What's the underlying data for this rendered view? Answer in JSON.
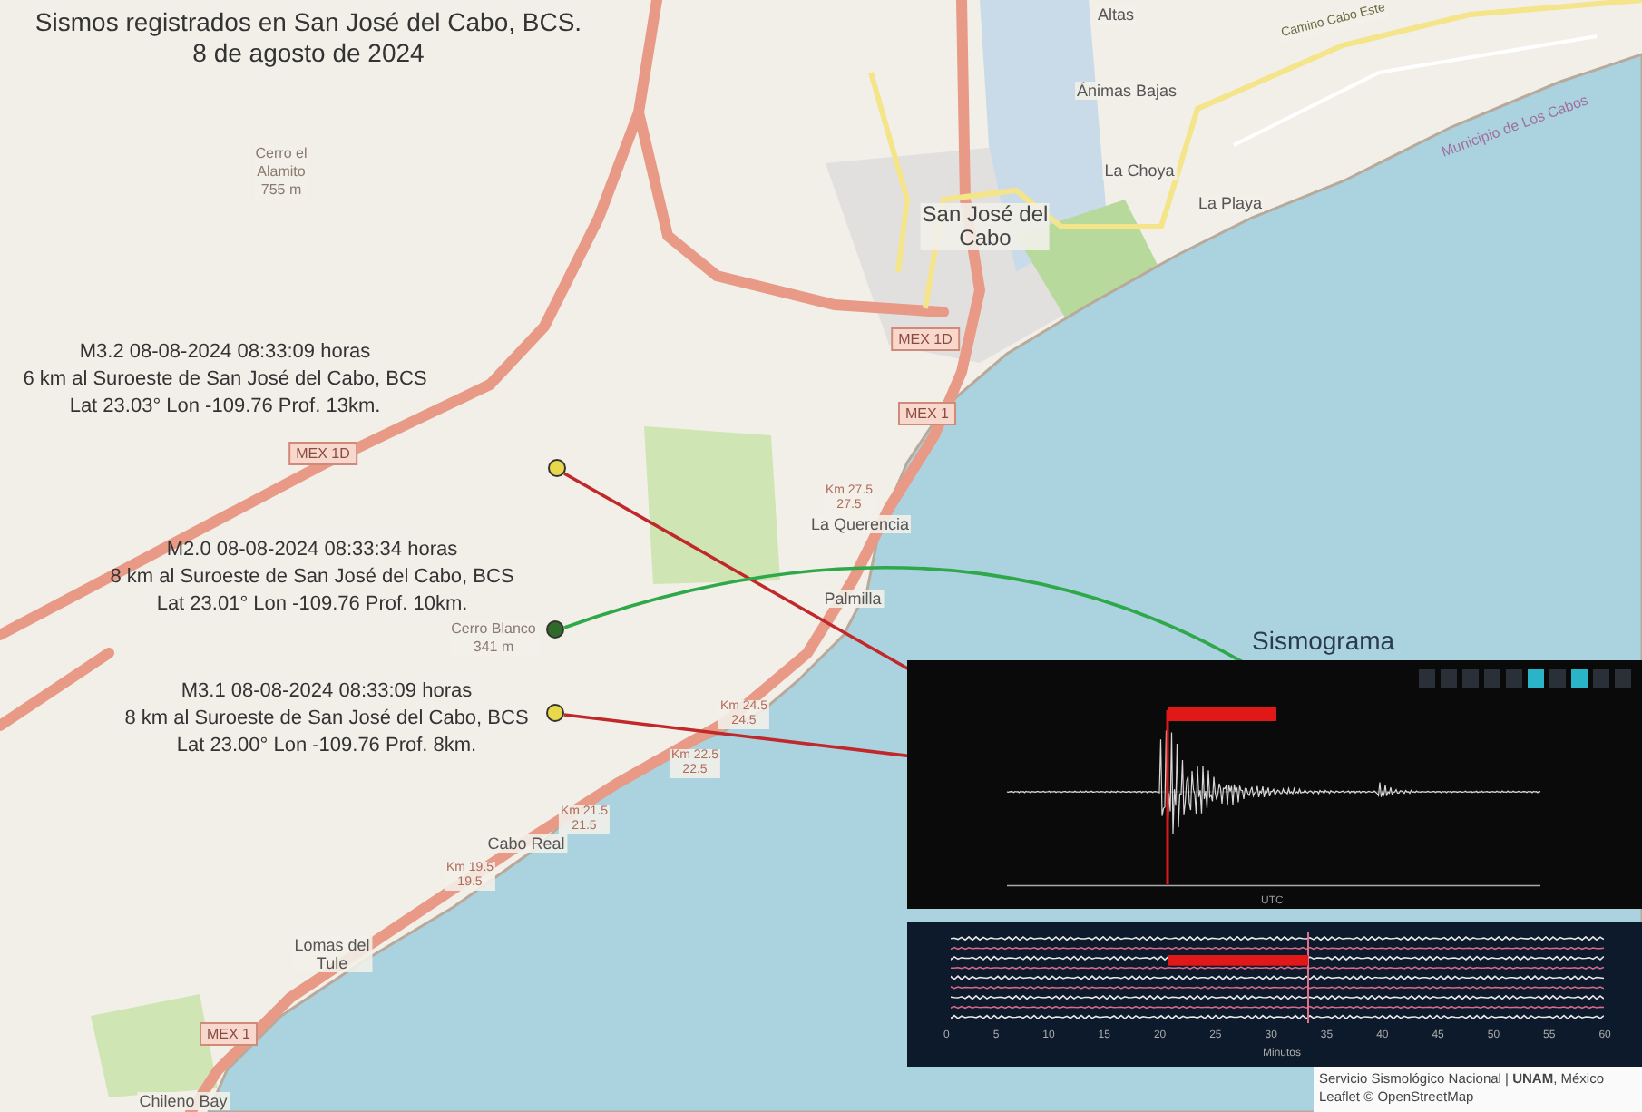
{
  "title": {
    "line_1": "Sismos registrados en San José del Cabo, BCS.",
    "line_2": "8 de agosto de 2024"
  },
  "map_labels": [
    {
      "kind": "peak",
      "lines": [
        "Cerro el",
        "Alamito",
        "755 m"
      ]
    },
    {
      "kind": "place",
      "lines": [
        "Altas"
      ]
    },
    {
      "kind": "place",
      "lines": [
        "Ánimas Bajas"
      ]
    },
    {
      "kind": "town",
      "lines": [
        "San José del",
        "Cabo"
      ]
    },
    {
      "kind": "place",
      "lines": [
        "La Choya"
      ]
    },
    {
      "kind": "place",
      "lines": [
        "La Playa"
      ]
    },
    {
      "kind": "road",
      "lines": [
        "Camino Cabo Este"
      ]
    },
    {
      "kind": "boundary",
      "lines": [
        "Municipio de Los Cabos"
      ]
    },
    {
      "kind": "place",
      "lines": [
        "La Querencia"
      ]
    },
    {
      "kind": "place",
      "lines": [
        "Palmilla"
      ]
    },
    {
      "kind": "peak",
      "lines": [
        "Cerro Blanco",
        "341 m"
      ]
    },
    {
      "kind": "km",
      "lines": [
        "Km 27.5",
        "27.5"
      ]
    },
    {
      "kind": "km",
      "lines": [
        "Km 24.5",
        "24.5"
      ]
    },
    {
      "kind": "km",
      "lines": [
        "Km 22.5",
        "22.5"
      ]
    },
    {
      "kind": "km",
      "lines": [
        "Km 21.5",
        "21.5"
      ]
    },
    {
      "kind": "km",
      "lines": [
        "Km 19.5",
        "19.5"
      ]
    },
    {
      "kind": "place",
      "lines": [
        "Cabo Real"
      ]
    },
    {
      "kind": "place",
      "lines": [
        "Lomas del",
        "Tule"
      ]
    },
    {
      "kind": "place",
      "lines": [
        "Chileno Bay"
      ]
    }
  ],
  "route_shields": [
    "MEX 1D",
    "MEX 1D",
    "MEX 1",
    "MEX 1"
  ],
  "events": [
    {
      "lines": [
        "M3.2 08-08-2024 08:33:09 horas",
        "6 km al Suroeste de San José del Cabo, BCS",
        "Lat 23.03° Lon -109.76 Prof. 13km."
      ],
      "color": "#e8d84a",
      "kind": "primary"
    },
    {
      "lines": [
        "M2.0 08-08-2024 08:33:34 horas",
        "8 km al Suroeste de San José del Cabo, BCS",
        "Lat 23.01° Lon -109.76 Prof. 10km."
      ],
      "color": "#2f6a2a",
      "kind": "secondary"
    },
    {
      "lines": [
        "M3.1 08-08-2024 08:33:09 horas",
        "8 km al Suroeste de San José del Cabo, BCS",
        "Lat 23.00° Lon -109.76 Prof. 8km."
      ],
      "color": "#e8d84a",
      "kind": "primary"
    }
  ],
  "seismogram": {
    "title": "Sismograma",
    "x_label": "UTC",
    "toolbar": [
      {
        "selected": false
      },
      {
        "selected": false
      },
      {
        "selected": false
      },
      {
        "selected": false
      },
      {
        "selected": false
      },
      {
        "selected": true
      },
      {
        "selected": false
      },
      {
        "selected": true
      },
      {
        "selected": false
      },
      {
        "selected": false
      }
    ]
  },
  "helicorder": {
    "x_ticks": [
      "0",
      "5",
      "10",
      "15",
      "20",
      "25",
      "30",
      "35",
      "40",
      "45",
      "50",
      "55",
      "60"
    ],
    "x_label": "Minutos"
  },
  "attribution": {
    "source": "Servicio Sismológico Nacional | **UNAM**, México",
    "credit": "Leaflet © OpenStreetMap"
  }
}
